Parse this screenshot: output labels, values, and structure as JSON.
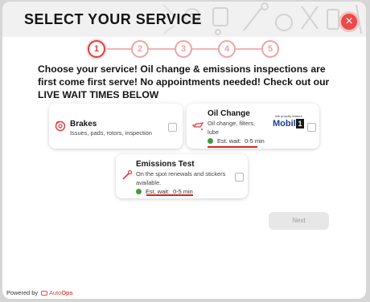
{
  "header": {
    "title": "SELECT YOUR SERVICE",
    "close_label": "×"
  },
  "steps": [
    {
      "label": "1",
      "active": true
    },
    {
      "label": "2",
      "active": false
    },
    {
      "label": "3",
      "active": false
    },
    {
      "label": "4",
      "active": false
    },
    {
      "label": "5",
      "active": false
    }
  ],
  "intro": "Choose your service! Oil change & emissions inspections are first come first serve! No appointments needed! Check out our LIVE WAIT TIMES BELOW",
  "services": {
    "brakes": {
      "title": "Brakes",
      "description": "Issues, pads, rotors, inspection",
      "icon": "brake-disc-icon",
      "checked": false
    },
    "oil_change": {
      "title": "Oil Change",
      "description": "Oil change, filters, lube",
      "icon": "oil-can-icon",
      "checked": false,
      "wait_label": "Est. wait:",
      "wait_value": "0-5 min",
      "partner_tagline": "We proudly feature",
      "partner_brand": "Mobil",
      "partner_number": "1"
    },
    "emissions": {
      "title": "Emissions Test",
      "description": "On the spot renewals and stickers available.",
      "icon": "gauge-tool-icon",
      "checked": false,
      "wait_label": "Est. wait:",
      "wait_value": "0-5 min"
    }
  },
  "next_label": "Next",
  "footer": {
    "powered_by": "Powered by",
    "brand_auto": "Auto",
    "brand_ops": "Ops"
  },
  "colors": {
    "accent": "#e03b3b",
    "status_green": "#3f9a3f",
    "underline_red": "#e01f1f",
    "mobil_blue": "#1a3f8a"
  }
}
